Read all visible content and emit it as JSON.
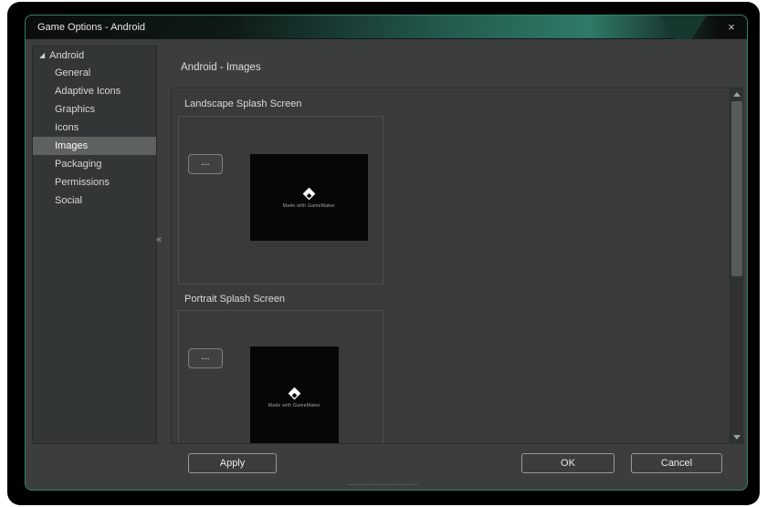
{
  "window": {
    "title": "Game Options - Android",
    "close_glyph": "×"
  },
  "sidebar": {
    "root_label": "Android",
    "expander_glyph": "◢",
    "collapse_glyph": "«",
    "items": [
      {
        "label": "General",
        "selected": false
      },
      {
        "label": "Adaptive Icons",
        "selected": false
      },
      {
        "label": "Graphics",
        "selected": false
      },
      {
        "label": "Icons",
        "selected": false
      },
      {
        "label": "Images",
        "selected": true
      },
      {
        "label": "Packaging",
        "selected": false
      },
      {
        "label": "Permissions",
        "selected": false
      },
      {
        "label": "Social",
        "selected": false
      }
    ]
  },
  "main": {
    "header": "Android - Images",
    "sections": [
      {
        "title": "Landscape Splash Screen",
        "browse_label": "...",
        "thumb_caption": "Made with GameMaker"
      },
      {
        "title": "Portrait Splash Screen",
        "browse_label": "...",
        "thumb_caption": "Made with GameMaker"
      }
    ]
  },
  "footer": {
    "apply_label": "Apply",
    "ok_label": "OK",
    "cancel_label": "Cancel"
  },
  "colors": {
    "accent_teal": "#2f7a68",
    "window_bg": "#3b3e3d",
    "selection": "#5d615f",
    "thumb_bg": "#060606"
  }
}
